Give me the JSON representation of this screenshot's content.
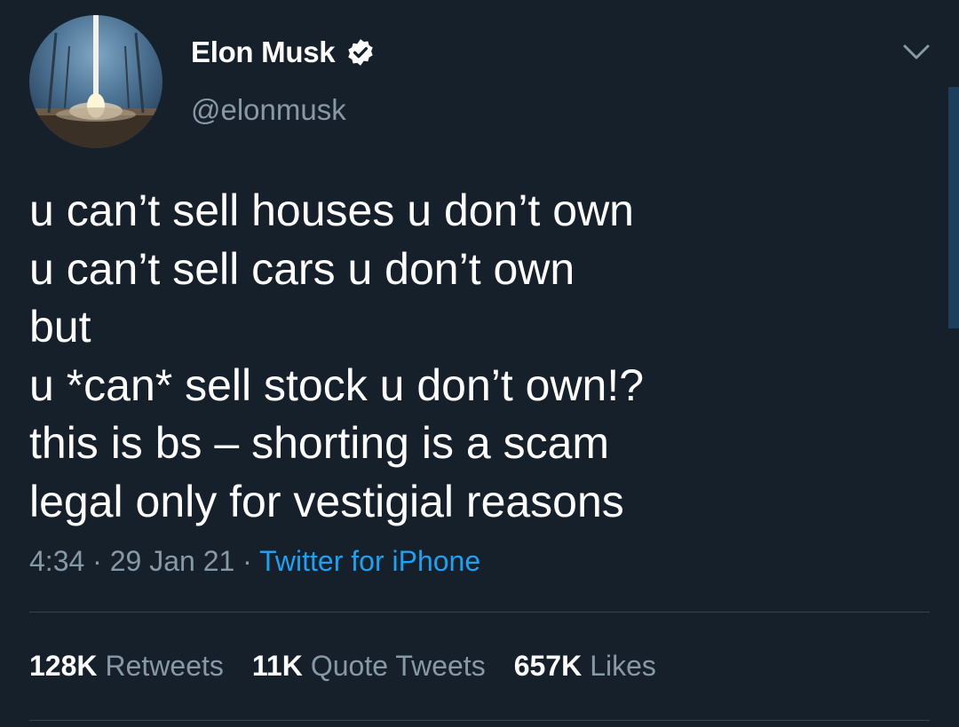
{
  "author": {
    "display_name": "Elon Musk",
    "handle": "@elonmusk",
    "verified": true
  },
  "tweet": {
    "lines": [
      "u can’t sell houses u don’t own",
      "u can’t sell cars u don’t own",
      "but",
      "u *can* sell stock u don’t own!?",
      "this is bs – shorting is a scam",
      "legal only for vestigial reasons"
    ],
    "time": "4:34",
    "date": "29 Jan 21",
    "source": "Twitter for iPhone",
    "separator": "·"
  },
  "stats": {
    "retweets_count": "128K",
    "retweets_label": "Retweets",
    "quotes_count": "11K",
    "quotes_label": "Quote Tweets",
    "likes_count": "657K",
    "likes_label": "Likes"
  },
  "icons": {
    "verified": "verified-badge-icon",
    "menu": "chevron-down-icon"
  },
  "colors": {
    "background": "#15202b",
    "secondary_text": "#8899a6",
    "link": "#1da1f2",
    "divider": "#38444d"
  }
}
